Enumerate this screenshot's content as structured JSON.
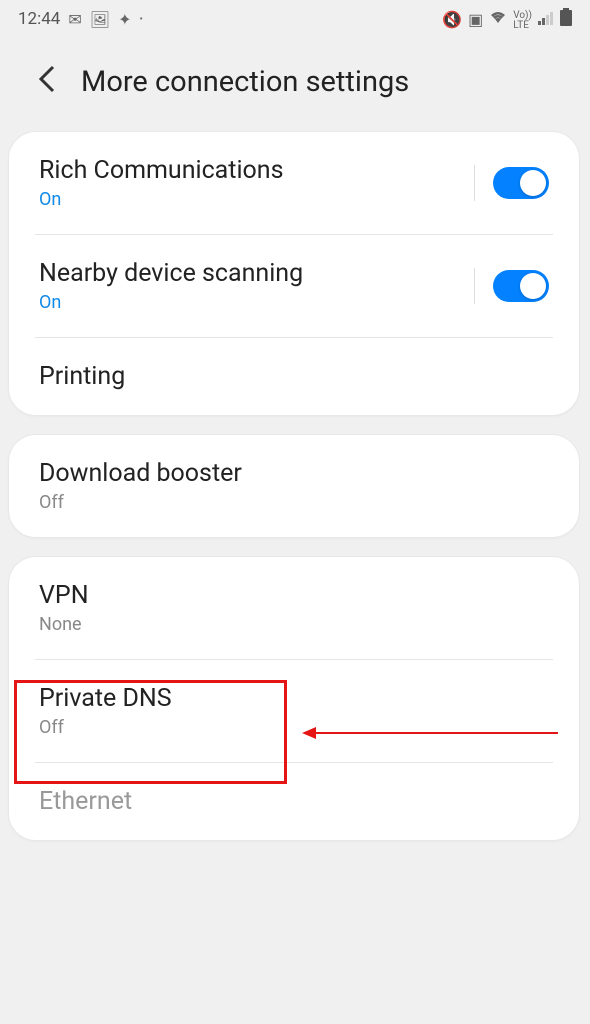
{
  "status": {
    "time": "12:44"
  },
  "header": {
    "title": "More connection settings"
  },
  "groups": [
    {
      "items": [
        {
          "title": "Rich Communications",
          "subtitle": "On",
          "subtitle_on": true,
          "toggle": true
        },
        {
          "title": "Nearby device scanning",
          "subtitle": "On",
          "subtitle_on": true,
          "toggle": true
        },
        {
          "title": "Printing"
        }
      ]
    },
    {
      "items": [
        {
          "title": "Download booster",
          "subtitle": "Off"
        }
      ]
    },
    {
      "items": [
        {
          "title": "VPN",
          "subtitle": "None"
        },
        {
          "title": "Private DNS",
          "subtitle": "Off"
        },
        {
          "title": "Ethernet",
          "disabled": true
        }
      ]
    }
  ]
}
